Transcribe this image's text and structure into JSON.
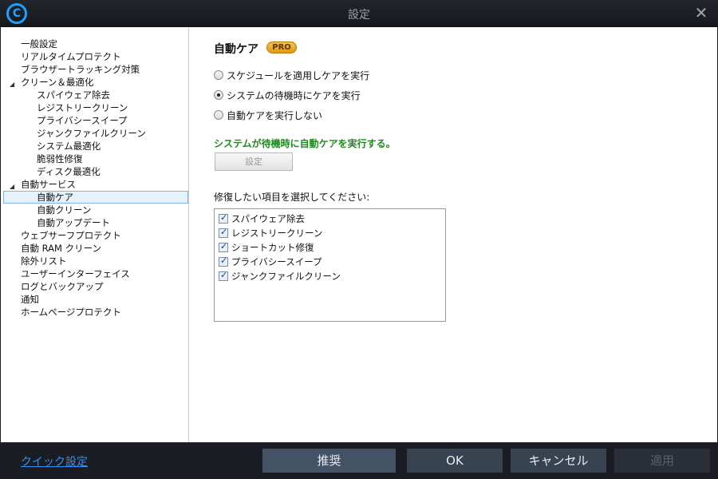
{
  "window": {
    "title": "設定",
    "close_glyph": "✕",
    "logo_glyph": "C"
  },
  "sidebar": {
    "items": [
      {
        "label": "一般設定",
        "level": 0
      },
      {
        "label": "リアルタイムプロテクト",
        "level": 0
      },
      {
        "label": "ブラウザートラッキング対策",
        "level": 0
      },
      {
        "label": "クリーン＆最適化",
        "level": 0,
        "expanded": true
      },
      {
        "label": "スパイウェア除去",
        "level": 1
      },
      {
        "label": "レジストリークリーン",
        "level": 1
      },
      {
        "label": "プライバシースイープ",
        "level": 1
      },
      {
        "label": "ジャンクファイルクリーン",
        "level": 1
      },
      {
        "label": "システム最適化",
        "level": 1
      },
      {
        "label": "脆弱性修復",
        "level": 1
      },
      {
        "label": "ディスク最適化",
        "level": 1
      },
      {
        "label": "自動サービス",
        "level": 0,
        "expanded": true
      },
      {
        "label": "自動ケア",
        "level": 1,
        "selected": true
      },
      {
        "label": "自動クリーン",
        "level": 1
      },
      {
        "label": "自動アップデート",
        "level": 1
      },
      {
        "label": "ウェブサーフプロテクト",
        "level": 0
      },
      {
        "label": "自動 RAM クリーン",
        "level": 0
      },
      {
        "label": "除外リスト",
        "level": 0
      },
      {
        "label": "ユーザーインターフェイス",
        "level": 0
      },
      {
        "label": "ログとバックアップ",
        "level": 0
      },
      {
        "label": "通知",
        "level": 0
      },
      {
        "label": "ホームページプロテクト",
        "level": 0
      }
    ]
  },
  "main": {
    "title": "自動ケア",
    "badge": "PRO",
    "options": [
      {
        "label": "スケジュールを適用しケアを実行",
        "checked": false
      },
      {
        "label": "システムの待機時にケアを実行",
        "checked": true
      },
      {
        "label": "自動ケアを実行しない",
        "checked": false
      }
    ],
    "note": "システムが待機時に自動ケアを実行する。",
    "settings_button": "設定",
    "list_label": "修復したい項目を選択してください:",
    "checklist": [
      {
        "label": "スパイウェア除去",
        "checked": true
      },
      {
        "label": "レジストリークリーン",
        "checked": true
      },
      {
        "label": "ショートカット修復",
        "checked": true
      },
      {
        "label": "プライバシースイープ",
        "checked": true
      },
      {
        "label": "ジャンクファイルクリーン",
        "checked": true
      }
    ]
  },
  "footer": {
    "quick_settings": "クイック設定",
    "recommend": "推奨",
    "ok": "OK",
    "cancel": "キャンセル",
    "apply": "適用"
  },
  "colors": {
    "accent": "#1ea0ff",
    "note_green": "#1f8a1f",
    "footer_bg": "#1a1d24"
  }
}
